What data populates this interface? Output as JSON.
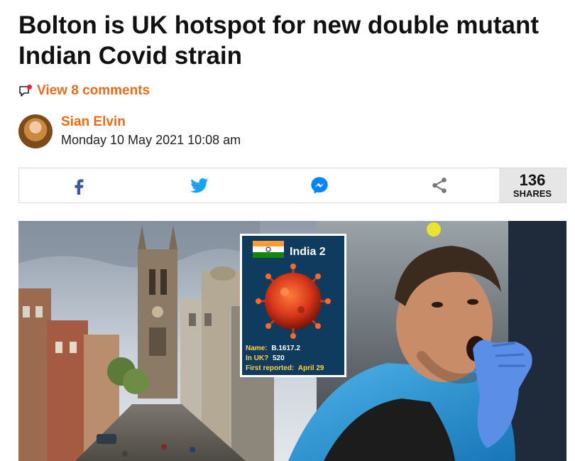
{
  "article": {
    "headline": "Bolton is UK hotspot for new double mutant Indian Covid strain",
    "comments_label": "View 8 comments",
    "author_name": "Sian Elvin",
    "date": "Monday 10 May 2021 10:08 am"
  },
  "share_bar": {
    "buttons": [
      {
        "icon": "facebook-icon",
        "color": "#3b5998"
      },
      {
        "icon": "twitter-icon",
        "color": "#1da1f2"
      },
      {
        "icon": "messenger-icon",
        "color": "#0084ff"
      },
      {
        "icon": "share-icon",
        "color": "#777777"
      }
    ],
    "count": "136",
    "count_label": "SHARES"
  },
  "hero_graphic": {
    "title": "India 2",
    "name_label": "Name:",
    "name_value": "B.1617.2",
    "uk_label": "In UK?",
    "uk_value": "520",
    "first_label": "First reported:",
    "first_value": "April 29"
  },
  "colors": {
    "accent": "#e56c1a",
    "infobox_bg": "#0e3b5e",
    "infobox_yellow": "#ffd23f"
  }
}
